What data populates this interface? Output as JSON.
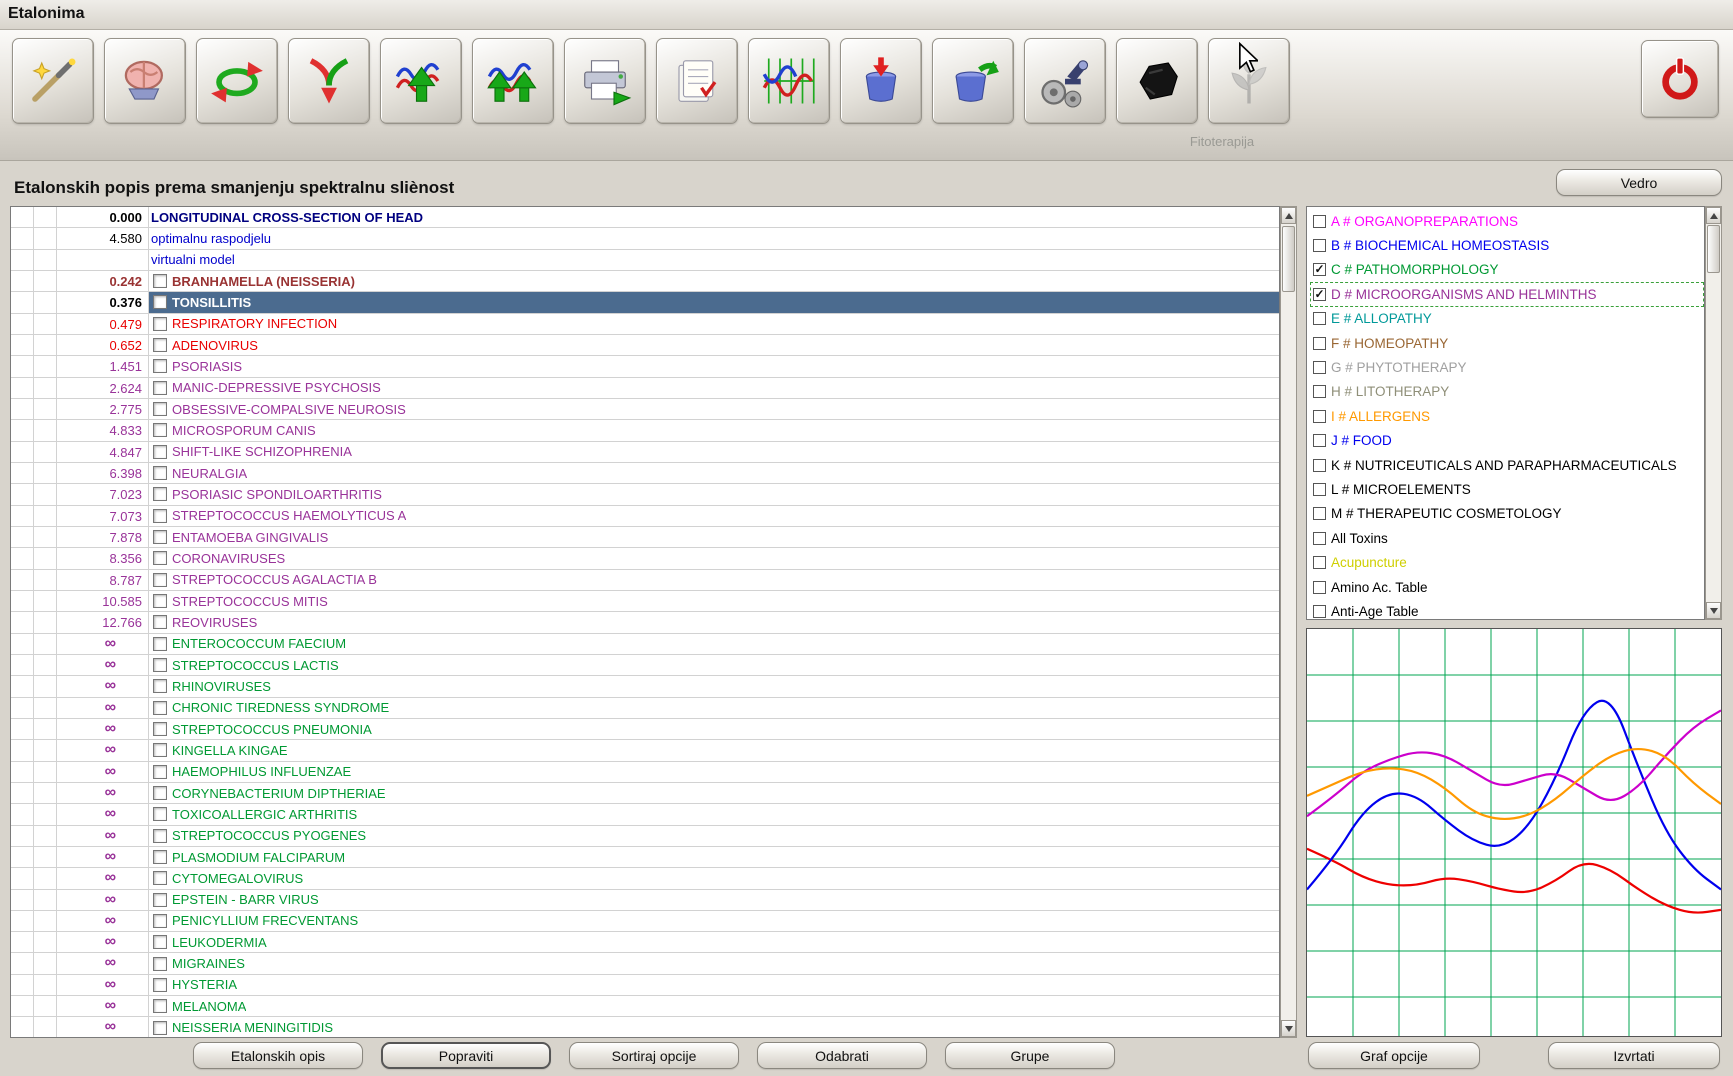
{
  "window": {
    "title": "Etalonima"
  },
  "toolbar": {
    "buttons": [
      {
        "icon": "magic-wand-icon",
        "disabled": false
      },
      {
        "icon": "brain-icon",
        "disabled": false
      },
      {
        "icon": "cycle-arrows-icon",
        "disabled": false
      },
      {
        "icon": "split-arrows-icon",
        "disabled": false
      },
      {
        "icon": "graph-export-icon",
        "disabled": false
      },
      {
        "icon": "graph-export-all-icon",
        "disabled": false
      },
      {
        "icon": "printer-icon",
        "disabled": false
      },
      {
        "icon": "card-index-icon",
        "disabled": false
      },
      {
        "icon": "spectrum-icon",
        "disabled": false
      },
      {
        "icon": "bucket-in-icon",
        "disabled": false
      },
      {
        "icon": "bucket-out-icon",
        "disabled": false
      },
      {
        "icon": "analysis-icon",
        "disabled": false
      },
      {
        "icon": "stone-icon",
        "disabled": false
      },
      {
        "icon": "plant-icon",
        "disabled": true
      }
    ],
    "disabled_label": "Fitoterapija",
    "exit_icon": "power-icon"
  },
  "list_header": {
    "title": "Etalonskih popis prema smanjenju spektralnu sliènost",
    "vedro_button": "Vedro"
  },
  "etalon_list": {
    "rows": [
      {
        "value": "0.000",
        "value_color": "#000000",
        "name": "LONGITUDINAL CROSS-SECTION OF HEAD",
        "name_color": "#000080",
        "bold": true,
        "checkbox": false,
        "selected": false
      },
      {
        "value": "4.580",
        "value_color": "#000000",
        "name": "optimalnu raspodjelu",
        "name_color": "#0000cc",
        "bold": false,
        "checkbox": false,
        "selected": false
      },
      {
        "value": "",
        "value_color": "#000000",
        "name": "virtualni model",
        "name_color": "#0000cc",
        "bold": false,
        "checkbox": false,
        "selected": false
      },
      {
        "value": "0.242",
        "value_color": "#993333",
        "name": "BRANHAMELLA (NEISSERIA)",
        "name_color": "#993333",
        "bold": true,
        "checkbox": true,
        "selected": false
      },
      {
        "value": "0.376",
        "value_color": "#000000",
        "name": "TONSILLITIS",
        "name_color": "#ffffff",
        "bold": true,
        "checkbox": true,
        "selected": true
      },
      {
        "value": "0.479",
        "value_color": "#e80000",
        "name": "RESPIRATORY INFECTION",
        "name_color": "#e80000",
        "bold": false,
        "checkbox": true,
        "selected": false
      },
      {
        "value": "0.652",
        "value_color": "#e80000",
        "name": "ADENOVIRUS",
        "name_color": "#e80000",
        "bold": false,
        "checkbox": true,
        "selected": false
      },
      {
        "value": "1.451",
        "value_color": "#993399",
        "name": "PSORIASIS",
        "name_color": "#993399",
        "bold": false,
        "checkbox": true,
        "selected": false
      },
      {
        "value": "2.624",
        "value_color": "#993399",
        "name": "MANIC-DEPRESSIVE PSYCHOSIS",
        "name_color": "#993399",
        "bold": false,
        "checkbox": true,
        "selected": false
      },
      {
        "value": "2.775",
        "value_color": "#993399",
        "name": "OBSESSIVE-COMPALSIVE NEUROSIS",
        "name_color": "#993399",
        "bold": false,
        "checkbox": true,
        "selected": false
      },
      {
        "value": "4.833",
        "value_color": "#993399",
        "name": "MICROSPORUM CANIS",
        "name_color": "#993399",
        "bold": false,
        "checkbox": true,
        "selected": false
      },
      {
        "value": "4.847",
        "value_color": "#993399",
        "name": "SHIFT-LIKE SCHIZOPHRENIA",
        "name_color": "#993399",
        "bold": false,
        "checkbox": true,
        "selected": false
      },
      {
        "value": "6.398",
        "value_color": "#993399",
        "name": "NEURALGIA",
        "name_color": "#993399",
        "bold": false,
        "checkbox": true,
        "selected": false
      },
      {
        "value": "7.023",
        "value_color": "#993399",
        "name": "PSORIASIC SPONDILOARTHRITIS",
        "name_color": "#993399",
        "bold": false,
        "checkbox": true,
        "selected": false
      },
      {
        "value": "7.073",
        "value_color": "#993399",
        "name": "STREPTOCOCCUS HAEMOLYTICUS A",
        "name_color": "#993399",
        "bold": false,
        "checkbox": true,
        "selected": false
      },
      {
        "value": "7.878",
        "value_color": "#993399",
        "name": "ENTAMOEBA GINGIVALIS",
        "name_color": "#993399",
        "bold": false,
        "checkbox": true,
        "selected": false
      },
      {
        "value": "8.356",
        "value_color": "#993399",
        "name": "CORONAVIRUSES",
        "name_color": "#993399",
        "bold": false,
        "checkbox": true,
        "selected": false
      },
      {
        "value": "8.787",
        "value_color": "#993399",
        "name": "STREPTOCOCCUS AGALACTIA B",
        "name_color": "#993399",
        "bold": false,
        "checkbox": true,
        "selected": false
      },
      {
        "value": "10.585",
        "value_color": "#993399",
        "name": "STREPTOCOCCUS MITIS",
        "name_color": "#993399",
        "bold": false,
        "checkbox": true,
        "selected": false
      },
      {
        "value": "12.766",
        "value_color": "#993399",
        "name": "REOVIRUSES",
        "name_color": "#993399",
        "bold": false,
        "checkbox": true,
        "selected": false
      },
      {
        "value": "∞",
        "value_color": "#993399",
        "name": "ENTEROCOCCUM FAECIUM",
        "name_color": "#009933",
        "bold": false,
        "checkbox": true,
        "selected": false
      },
      {
        "value": "∞",
        "value_color": "#993399",
        "name": "STREPTOCOCCUS LACTIS",
        "name_color": "#009933",
        "bold": false,
        "checkbox": true,
        "selected": false
      },
      {
        "value": "∞",
        "value_color": "#993399",
        "name": "RHINOVIRUSES",
        "name_color": "#009933",
        "bold": false,
        "checkbox": true,
        "selected": false
      },
      {
        "value": "∞",
        "value_color": "#993399",
        "name": "CHRONIC TIREDNESS SYNDROME",
        "name_color": "#009933",
        "bold": false,
        "checkbox": true,
        "selected": false
      },
      {
        "value": "∞",
        "value_color": "#993399",
        "name": "STREPTOCOCCUS PNEUMONIA",
        "name_color": "#009933",
        "bold": false,
        "checkbox": true,
        "selected": false
      },
      {
        "value": "∞",
        "value_color": "#993399",
        "name": "KINGELLA KINGAE",
        "name_color": "#009933",
        "bold": false,
        "checkbox": true,
        "selected": false
      },
      {
        "value": "∞",
        "value_color": "#993399",
        "name": "HAEMOPHILUS INFLUENZAE",
        "name_color": "#009933",
        "bold": false,
        "checkbox": true,
        "selected": false
      },
      {
        "value": "∞",
        "value_color": "#993399",
        "name": "CORYNEBACTERIUM DIPTHERIAE",
        "name_color": "#009933",
        "bold": false,
        "checkbox": true,
        "selected": false
      },
      {
        "value": "∞",
        "value_color": "#993399",
        "name": "TOXICOALLERGIC ARTHRITIS",
        "name_color": "#009933",
        "bold": false,
        "checkbox": true,
        "selected": false
      },
      {
        "value": "∞",
        "value_color": "#993399",
        "name": "STREPTOCOCCUS PYOGENES",
        "name_color": "#009933",
        "bold": false,
        "checkbox": true,
        "selected": false
      },
      {
        "value": "∞",
        "value_color": "#993399",
        "name": "PLASMODIUM FALCIPARUM",
        "name_color": "#009933",
        "bold": false,
        "checkbox": true,
        "selected": false
      },
      {
        "value": "∞",
        "value_color": "#993399",
        "name": "CYTOMEGALOVIRUS",
        "name_color": "#009933",
        "bold": false,
        "checkbox": true,
        "selected": false
      },
      {
        "value": "∞",
        "value_color": "#993399",
        "name": "EPSTEIN - BARR VIRUS",
        "name_color": "#009933",
        "bold": false,
        "checkbox": true,
        "selected": false
      },
      {
        "value": "∞",
        "value_color": "#993399",
        "name": "PENICYLLIUM FRECVENTANS",
        "name_color": "#009933",
        "bold": false,
        "checkbox": true,
        "selected": false
      },
      {
        "value": "∞",
        "value_color": "#993399",
        "name": "LEUKODERMIA",
        "name_color": "#009933",
        "bold": false,
        "checkbox": true,
        "selected": false
      },
      {
        "value": "∞",
        "value_color": "#993399",
        "name": "MIGRAINES",
        "name_color": "#009933",
        "bold": false,
        "checkbox": true,
        "selected": false
      },
      {
        "value": "∞",
        "value_color": "#993399",
        "name": "HYSTERIA",
        "name_color": "#009933",
        "bold": false,
        "checkbox": true,
        "selected": false
      },
      {
        "value": "∞",
        "value_color": "#993399",
        "name": "MELANOMA",
        "name_color": "#009933",
        "bold": false,
        "checkbox": true,
        "selected": false
      },
      {
        "value": "∞",
        "value_color": "#993399",
        "name": "NEISSERIA MENINGITIDIS",
        "name_color": "#009933",
        "bold": false,
        "checkbox": true,
        "selected": false
      }
    ]
  },
  "categories": {
    "items": [
      {
        "label": "A # ORGANOPREPARATIONS",
        "color": "#ff00ff",
        "checked": false,
        "focused": false
      },
      {
        "label": "B # BIOCHEMICAL HOMEOSTASIS",
        "color": "#0000ee",
        "checked": false,
        "focused": false
      },
      {
        "label": "C # PATHOMORPHOLOGY",
        "color": "#009933",
        "checked": true,
        "focused": false
      },
      {
        "label": "D # MICROORGANISMS AND HELMINTHS",
        "color": "#993399",
        "checked": true,
        "focused": true
      },
      {
        "label": "E # ALLOPATHY",
        "color": "#009999",
        "checked": false,
        "focused": false
      },
      {
        "label": "F # HOMEOPATHY",
        "color": "#996633",
        "checked": false,
        "focused": false
      },
      {
        "label": "G # PHYTOTHERAPY",
        "color": "#a0a0a0",
        "checked": false,
        "focused": false
      },
      {
        "label": "H # LITOTHERAPY",
        "color": "#8f8f78",
        "checked": false,
        "focused": false
      },
      {
        "label": "I # ALLERGENS",
        "color": "#ff9900",
        "checked": false,
        "focused": false
      },
      {
        "label": "J # FOOD",
        "color": "#0000ee",
        "checked": false,
        "focused": false
      },
      {
        "label": "K # NUTRICEUTICALS AND PARAPHARMACEUTICALS",
        "color": "#000000",
        "checked": false,
        "focused": false
      },
      {
        "label": "L # MICROELEMENTS",
        "color": "#000000",
        "checked": false,
        "focused": false
      },
      {
        "label": "M # THERAPEUTIC COSMETOLOGY",
        "color": "#000000",
        "checked": false,
        "focused": false
      },
      {
        "label": "All Toxins",
        "color": "#000000",
        "checked": false,
        "focused": false
      },
      {
        "label": "Acupuncture",
        "color": "#cfcf00",
        "checked": false,
        "focused": false
      },
      {
        "label": "Amino Ac. Table",
        "color": "#000000",
        "checked": false,
        "focused": false
      },
      {
        "label": "Anti-Age Table",
        "color": "#000000",
        "checked": false,
        "focused": false
      }
    ]
  },
  "graph": {
    "grid_color": "#00a651",
    "series": [
      {
        "name": "red-curve",
        "color": "#ee0000",
        "values": [
          46,
          43,
          39,
          37,
          37,
          39,
          38,
          36,
          35,
          38,
          43,
          41,
          36,
          32,
          30,
          31
        ]
      },
      {
        "name": "blue-curve",
        "color": "#0000ee",
        "values": [
          36,
          44,
          55,
          60,
          59,
          53,
          48,
          46,
          51,
          63,
          80,
          84,
          66,
          50,
          41,
          36
        ]
      },
      {
        "name": "magenta-curve",
        "color": "#cc00cc",
        "values": [
          54,
          59,
          65,
          68,
          70,
          69,
          65,
          61,
          63,
          65,
          61,
          57,
          61,
          69,
          76,
          80
        ]
      },
      {
        "name": "orange-curve",
        "color": "#ff9900",
        "values": [
          59,
          62,
          65,
          66,
          65,
          61,
          55,
          53,
          54,
          58,
          64,
          69,
          71,
          69,
          62,
          57
        ]
      }
    ]
  },
  "footer": {
    "list_buttons": [
      {
        "label": "Etalonskih opis",
        "default": false
      },
      {
        "label": "Popraviti",
        "default": true
      },
      {
        "label": "Sortiraj opcije",
        "default": false
      },
      {
        "label": "Odabrati",
        "default": false
      },
      {
        "label": "Grupe",
        "default": false
      }
    ],
    "graph_buttons": [
      {
        "label": "Graf opcije",
        "default": false
      },
      {
        "label": "Izvrtati",
        "default": false
      }
    ]
  }
}
